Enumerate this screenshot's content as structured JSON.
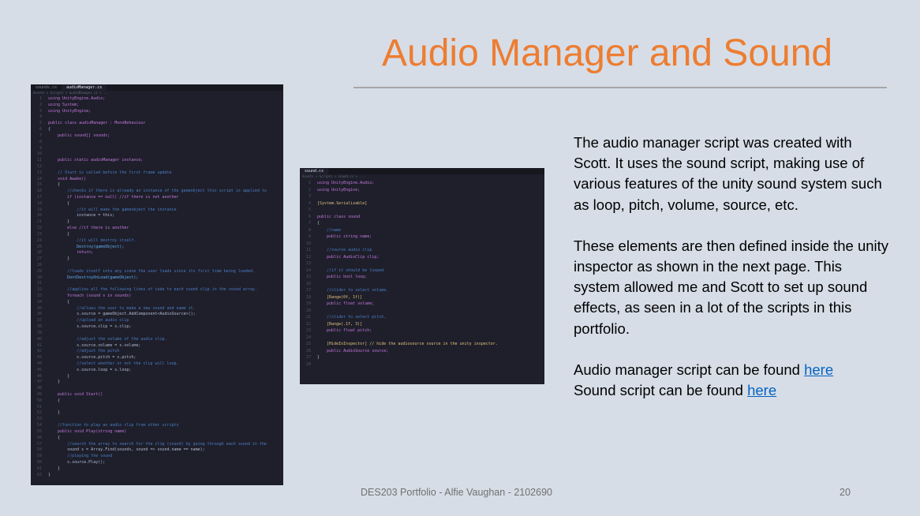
{
  "slide": {
    "title": "Audio Manager and Sound",
    "paragraph1": "The audio manager script was created with Scott. It uses the sound script, making use of various features of the unity sound system such as loop, pitch, volume, source, etc.",
    "paragraph2": "These elements are then defined inside the unity inspector as shown in the next page. This system allowed me and Scott to set up sound effects, as seen in a lot of the scripts in this portfolio.",
    "audio_link_prefix": "Audio manager script can be found ",
    "audio_link_text": "here",
    "sound_link_prefix": "Sound script can be found ",
    "sound_link_text": "here",
    "footer": "DES203 Portfolio - Alfie Vaughan - 2102690",
    "page_number": "20"
  },
  "colors": {
    "title": "#ed7d31",
    "link": "#0563c1",
    "background": "#d6dde7",
    "editor_bg": "#1e1f2b"
  },
  "code_left": {
    "tab_inactive": "sounds.cs",
    "tab_active": "audioManager.cs",
    "breadcrumb": "Assets > Scripts > audioManager.cs > ...",
    "lines": [
      {
        "n": "1",
        "t": "using UnityEngine.Audio;"
      },
      {
        "n": "2",
        "t": "using System;"
      },
      {
        "n": "3",
        "t": "using UnityEngine;"
      },
      {
        "n": "4",
        "t": ""
      },
      {
        "n": "5",
        "t": "public class audioManager : MonoBehaviour"
      },
      {
        "n": "6",
        "t": "{"
      },
      {
        "n": "7",
        "t": "    public sound[] sounds;"
      },
      {
        "n": "8",
        "t": ""
      },
      {
        "n": "9",
        "t": ""
      },
      {
        "n": "10",
        "t": ""
      },
      {
        "n": "11",
        "t": "    public static audioManager instance;"
      },
      {
        "n": "12",
        "t": ""
      },
      {
        "n": "13",
        "t": "    // Start is called before the first frame update"
      },
      {
        "n": "14",
        "t": "    void Awake()"
      },
      {
        "n": "15",
        "t": "    {"
      },
      {
        "n": "16",
        "t": "        //checks if there is already an instance of the gameobject this script is applied to"
      },
      {
        "n": "17",
        "t": "        if (instance == null) //if there is not another"
      },
      {
        "n": "18",
        "t": "        {"
      },
      {
        "n": "19",
        "t": "            //it will make the gameobject the instance"
      },
      {
        "n": "20",
        "t": "            instance = this;"
      },
      {
        "n": "21",
        "t": "        }"
      },
      {
        "n": "22",
        "t": "        else //if there is another"
      },
      {
        "n": "23",
        "t": "        {"
      },
      {
        "n": "24",
        "t": "            //it will destroy itself."
      },
      {
        "n": "25",
        "t": "            Destroy(gameObject);"
      },
      {
        "n": "26",
        "t": "            return;"
      },
      {
        "n": "27",
        "t": "        }"
      },
      {
        "n": "28",
        "t": ""
      },
      {
        "n": "29",
        "t": "        //loads itself into any scene the user loads since its first time being loaded."
      },
      {
        "n": "30",
        "t": "        DontDestroyOnLoad(gameObject);"
      },
      {
        "n": "31",
        "t": ""
      },
      {
        "n": "32",
        "t": "        //applies all the following lines of code to each sound clip in the sound array."
      },
      {
        "n": "33",
        "t": "        foreach (sound s in sounds)"
      },
      {
        "n": "34",
        "t": "        {"
      },
      {
        "n": "35",
        "t": "            //allows the user to make a new sound and name it."
      },
      {
        "n": "36",
        "t": "            s.source = gameObject.AddComponent<AudioSource>();"
      },
      {
        "n": "37",
        "t": "            //upload an audio clip"
      },
      {
        "n": "38",
        "t": "            s.source.clip = s.clip;"
      },
      {
        "n": "39",
        "t": ""
      },
      {
        "n": "40",
        "t": "            //adjust the volume of the audio clip."
      },
      {
        "n": "41",
        "t": "            s.source.volume = s.volume;"
      },
      {
        "n": "42",
        "t": "            //adjust the pitch"
      },
      {
        "n": "43",
        "t": "            s.source.pitch = s.pitch;"
      },
      {
        "n": "44",
        "t": "            //select whether or not the clip will loop."
      },
      {
        "n": "45",
        "t": "            s.source.loop = s.loop;"
      },
      {
        "n": "46",
        "t": "        }"
      },
      {
        "n": "47",
        "t": "    }"
      },
      {
        "n": "48",
        "t": ""
      },
      {
        "n": "49",
        "t": "    public void Start()"
      },
      {
        "n": "50",
        "t": "    {"
      },
      {
        "n": "51",
        "t": ""
      },
      {
        "n": "52",
        "t": "    }"
      },
      {
        "n": "53",
        "t": ""
      },
      {
        "n": "54",
        "t": "    //function to play an audio clip from other scripts"
      },
      {
        "n": "55",
        "t": "    public void Play(string name)"
      },
      {
        "n": "56",
        "t": "    {"
      },
      {
        "n": "57",
        "t": "        //search the array to search for the clip (sound) by going through each sound in the"
      },
      {
        "n": "58",
        "t": "        sound s = Array.Find(sounds, sound => sound.name == name);"
      },
      {
        "n": "59",
        "t": "        //playing the sound"
      },
      {
        "n": "60",
        "t": "        s.source.Play();"
      },
      {
        "n": "61",
        "t": "    }"
      },
      {
        "n": "62",
        "t": "}"
      }
    ]
  },
  "code_right": {
    "tab_active": "sound.cs",
    "breadcrumb": "Assets > Scripts > sound.cs > ...",
    "lines": [
      {
        "n": "1",
        "t": "using UnityEngine.Audio;"
      },
      {
        "n": "2",
        "t": "using UnityEngine;"
      },
      {
        "n": "3",
        "t": ""
      },
      {
        "n": "4",
        "t": "[System.Serializable]"
      },
      {
        "n": "5",
        "t": ""
      },
      {
        "n": "6",
        "t": "public class sound"
      },
      {
        "n": "7",
        "t": "{"
      },
      {
        "n": "8",
        "t": "    //name"
      },
      {
        "n": "9",
        "t": "    public string name;"
      },
      {
        "n": "10",
        "t": ""
      },
      {
        "n": "11",
        "t": "    //source audio clip"
      },
      {
        "n": "12",
        "t": "    public AudioClip clip;"
      },
      {
        "n": "13",
        "t": ""
      },
      {
        "n": "14",
        "t": "    //if it should be looped"
      },
      {
        "n": "15",
        "t": "    public bool loop;"
      },
      {
        "n": "16",
        "t": ""
      },
      {
        "n": "17",
        "t": "    //slider to select volume."
      },
      {
        "n": "18",
        "t": "    [Range(0f, 1f)]"
      },
      {
        "n": "19",
        "t": "    public float volume;"
      },
      {
        "n": "20",
        "t": ""
      },
      {
        "n": "21",
        "t": "    //slider to select pitch."
      },
      {
        "n": "22",
        "t": "    [Range(.1f, 3)]"
      },
      {
        "n": "23",
        "t": "    public float pitch;"
      },
      {
        "n": "24",
        "t": ""
      },
      {
        "n": "25",
        "t": "    [HideInInspector] // hide the audiosource source in the unity inspector."
      },
      {
        "n": "26",
        "t": "    public AudioSource source;"
      },
      {
        "n": "27",
        "t": "}"
      },
      {
        "n": "28",
        "t": ""
      }
    ]
  }
}
